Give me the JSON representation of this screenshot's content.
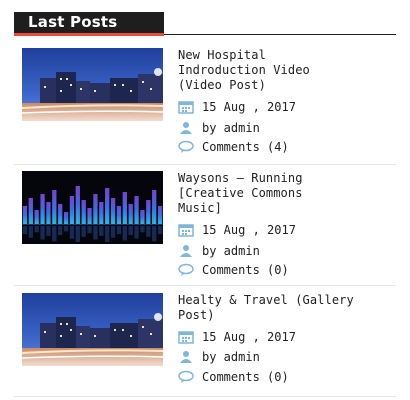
{
  "widget": {
    "title": "Last Posts"
  },
  "posts": [
    {
      "title_lines": [
        "New Hospital",
        "Indroduction Video",
        "(Video Post)"
      ],
      "date": "15 Aug , 2017",
      "author": "by admin",
      "comments": "Comments (4)",
      "thumbnail": "city-night"
    },
    {
      "title_lines": [
        "Waysons – Running",
        "[Creative Commons",
        "Music]"
      ],
      "date": "15 Aug , 2017",
      "author": "by admin",
      "comments": "Comments (0)",
      "thumbnail": "audio-equalizer"
    },
    {
      "title_lines": [
        "Healty & Travel (Gallery",
        "Post)"
      ],
      "date": "15 Aug , 2017",
      "author": "by admin",
      "comments": "Comments (0)",
      "thumbnail": "city-night"
    }
  ],
  "icons": {
    "date": "calendar-icon",
    "author": "user-icon",
    "comments": "comment-icon"
  },
  "colors": {
    "accent": "#e74c3c",
    "header_bg": "#1e1e1e",
    "icon": "#7fb6dc"
  }
}
